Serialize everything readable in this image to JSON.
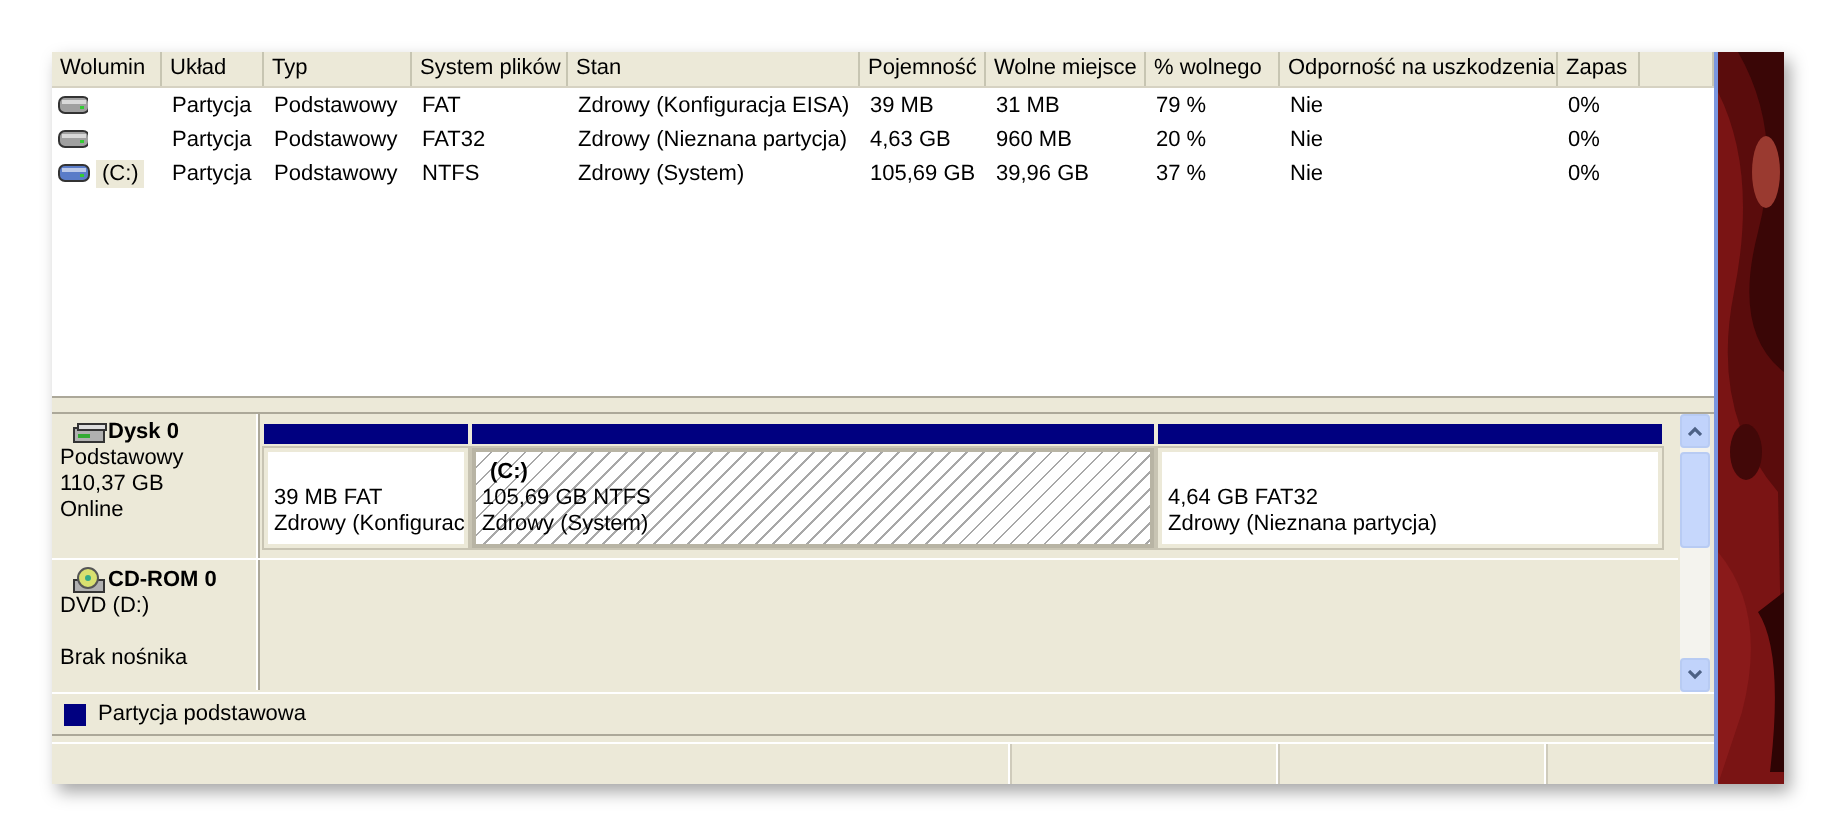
{
  "volume_list": {
    "columns": [
      "Wolumin",
      "Układ",
      "Typ",
      "System plików",
      "Stan",
      "Pojemność",
      "Wolne miejsce",
      "% wolnego",
      "Odporność na uszkodzenia",
      "Zapas"
    ],
    "rows": [
      {
        "color": "#a0a0a0",
        "selected": false,
        "cells": [
          "",
          "Partycja",
          "Podstawowy",
          "FAT",
          "Zdrowy (Konfiguracja EISA)",
          "39 MB",
          "31 MB",
          "79 %",
          "Nie",
          "0%"
        ]
      },
      {
        "color": "#a0a0a0",
        "selected": false,
        "cells": [
          "",
          "Partycja",
          "Podstawowy",
          "FAT32",
          "Zdrowy (Nieznana partycja)",
          "4,63 GB",
          "960 MB",
          "20 %",
          "Nie",
          "0%"
        ]
      },
      {
        "color": "#5a7cc8",
        "selected": true,
        "cells": [
          "(C:)",
          "Partycja",
          "Podstawowy",
          "NTFS",
          "Zdrowy (System)",
          "105,69 GB",
          "39,96 GB",
          "37 %",
          "Nie",
          "0%"
        ]
      }
    ]
  },
  "disks": [
    {
      "kind": "disk",
      "name": "Dysk 0",
      "type": "Podstawowy",
      "size": "110,37 GB",
      "status": "Online",
      "partitions": [
        {
          "size": "39 MB FAT",
          "state": "Zdrowy (Konfigurac",
          "selected": false
        },
        {
          "label": "(C:)",
          "size": "105,69 GB NTFS",
          "state": "Zdrowy (System)",
          "selected": true
        },
        {
          "size": "4,64 GB FAT32",
          "state": "Zdrowy (Nieznana partycja)",
          "selected": false
        }
      ]
    },
    {
      "kind": "cdrom",
      "name": "CD-ROM 0",
      "type": "DVD (D:)",
      "status": "Brak nośnika"
    }
  ],
  "legend": [
    {
      "label": "Partycja podstawowa",
      "color": "#000080"
    }
  ]
}
